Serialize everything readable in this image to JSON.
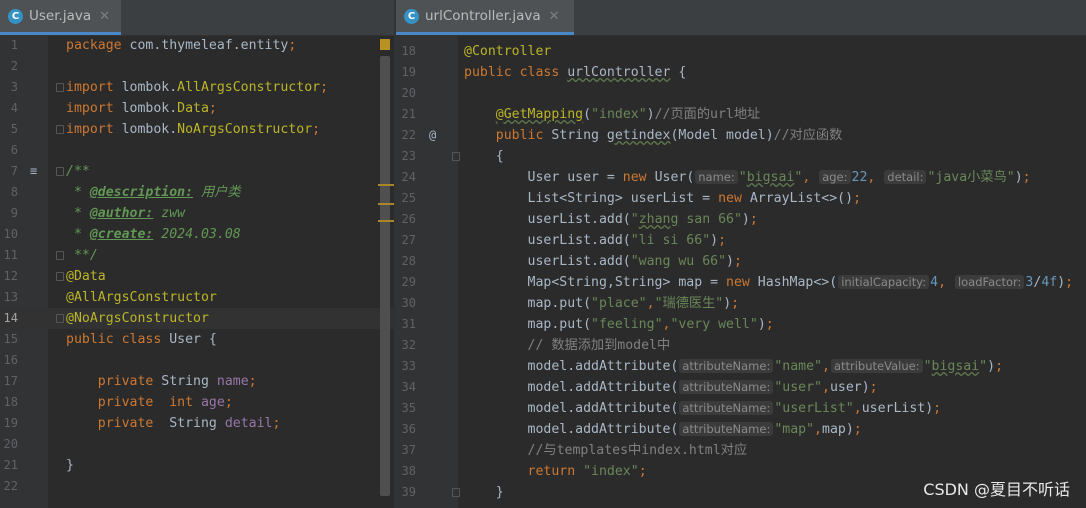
{
  "left": {
    "tab": {
      "label": "User.java",
      "icon": "C"
    },
    "lines": [
      {
        "n": "1",
        "html": "<span class=\"kw\">package </span>com.thymeleaf.entity<span class=\"kw\">;</span>"
      },
      {
        "n": "2",
        "html": ""
      },
      {
        "n": "3",
        "html": "<span class=\"kw\">import </span>lombok.<span class=\"an\">AllArgsConstructor</span><span class=\"kw\">;</span>"
      },
      {
        "n": "4",
        "html": "<span class=\"kw\">import </span>lombok.<span class=\"an\">Data</span><span class=\"kw\">;</span>"
      },
      {
        "n": "5",
        "html": "<span class=\"kw\">import </span>lombok.<span class=\"an\">NoArgsConstructor</span><span class=\"kw\">;</span>"
      },
      {
        "n": "6",
        "html": ""
      },
      {
        "n": "7",
        "html": "<span class=\"dc\">/**</span>"
      },
      {
        "n": "8",
        "html": "<span class=\"dc\"> * </span><span class=\"dt\">@description:</span><span class=\"dc\"> 用户类</span>"
      },
      {
        "n": "9",
        "html": "<span class=\"dc\"> * </span><span class=\"dt\">@author:</span><span class=\"dc\"> zww</span>"
      },
      {
        "n": "10",
        "html": "<span class=\"dc\"> * </span><span class=\"dt\">@create:</span><span class=\"dc\"> 2024.03.08</span>"
      },
      {
        "n": "11",
        "html": "<span class=\"dc\"> **/</span>"
      },
      {
        "n": "12",
        "html": "<span class=\"an\">@Data</span>"
      },
      {
        "n": "13",
        "html": "<span class=\"an\">@AllArgsConstructor</span>"
      },
      {
        "n": "14",
        "html": "<span class=\"an\">@NoArgsConstructor</span>"
      },
      {
        "n": "15",
        "html": "<span class=\"kw\">public class </span>User {"
      },
      {
        "n": "16",
        "html": ""
      },
      {
        "n": "17",
        "html": "    <span class=\"kw\">private </span>String <span class=\"fd\">name</span><span class=\"kw\">;</span>"
      },
      {
        "n": "18",
        "html": "    <span class=\"kw\">private  int </span><span class=\"fd\">age</span><span class=\"kw\">;</span>"
      },
      {
        "n": "19",
        "html": "    <span class=\"kw\">private  </span>String <span class=\"fd\">detail</span><span class=\"kw\">;</span>"
      },
      {
        "n": "20",
        "html": ""
      },
      {
        "n": "21",
        "html": "}"
      },
      {
        "n": "22",
        "html": ""
      }
    ]
  },
  "right": {
    "tab": {
      "label": "urlController.java",
      "icon": "C"
    },
    "lines": [
      {
        "n": "18",
        "html": "<span class=\"an\">@Controller</span>"
      },
      {
        "n": "19",
        "html": "<span class=\"kw\">public class </span><span class=\"wavy\">urlController</span> {"
      },
      {
        "n": "20",
        "html": ""
      },
      {
        "n": "21",
        "html": "    <span class=\"an wavy\">@GetMapping</span>(<span class=\"st\">\"index\"</span>)<span class=\"cm\">//页面的url地址</span>"
      },
      {
        "n": "22",
        "html": "    <span class=\"kw\">public </span>String <span class=\"wavy\">getindex</span>(Model model)<span class=\"cm\">//对应函数</span>"
      },
      {
        "n": "23",
        "html": "    {"
      },
      {
        "n": "24",
        "html": "        User user = <span class=\"kw\">new </span>User(<span class=\"hint\">name:</span><span class=\"st\">\"<span class=\"wavy\">bigsai</span>\"</span><span class=\"kw\">, </span><span class=\"hint\">age:</span><span class=\"nm\">22</span><span class=\"kw\">, </span><span class=\"hint\">detail:</span><span class=\"st\">\"java小菜鸟\"</span>)<span class=\"kw\">;</span>"
      },
      {
        "n": "25",
        "html": "        List&lt;String&gt; userList = <span class=\"kw\">new </span>ArrayList&lt;&gt;()<span class=\"kw\">;</span>"
      },
      {
        "n": "26",
        "html": "        userList.add(<span class=\"st\">\"<span class=\"wavy\">zhang</span> san 66\"</span>)<span class=\"kw\">;</span>"
      },
      {
        "n": "27",
        "html": "        userList.add(<span class=\"st\">\"li si 66\"</span>)<span class=\"kw\">;</span>"
      },
      {
        "n": "28",
        "html": "        userList.add(<span class=\"st\">\"wang wu 66\"</span>)<span class=\"kw\">;</span>"
      },
      {
        "n": "29",
        "html": "        Map&lt;String,String&gt; map = <span class=\"kw\">new </span>HashMap&lt;&gt;(<span class=\"hint\">initialCapacity:</span><span class=\"nm\">4</span><span class=\"kw\">, </span><span class=\"hint\">loadFactor:</span><span class=\"nm\">3</span>/<span class=\"nm\">4f</span>)<span class=\"kw\">;</span>"
      },
      {
        "n": "30",
        "html": "        map.put(<span class=\"st\">\"place\"</span><span class=\"kw\">,</span><span class=\"st\">\"瑞德医生\"</span>)<span class=\"kw\">;</span>"
      },
      {
        "n": "31",
        "html": "        map.put(<span class=\"st\">\"feeling\"</span><span class=\"kw\">,</span><span class=\"st\">\"very well\"</span>)<span class=\"kw\">;</span>"
      },
      {
        "n": "32",
        "html": "        <span class=\"cm\">// 数据添加到model中</span>"
      },
      {
        "n": "33",
        "html": "        model.addAttribute(<span class=\"hint\">attributeName:</span><span class=\"st\">\"name\"</span><span class=\"kw\">,</span><span class=\"hint\">attributeValue:</span><span class=\"st\">\"<span class=\"wavy\">bigsai</span>\"</span>)<span class=\"kw\">;</span>"
      },
      {
        "n": "34",
        "html": "        model.addAttribute(<span class=\"hint\">attributeName:</span><span class=\"st\">\"user\"</span><span class=\"kw\">,</span>user)<span class=\"kw\">;</span>"
      },
      {
        "n": "35",
        "html": "        model.addAttribute(<span class=\"hint\">attributeName:</span><span class=\"st\">\"userList\"</span><span class=\"kw\">,</span>userList)<span class=\"kw\">;</span>"
      },
      {
        "n": "36",
        "html": "        model.addAttribute(<span class=\"hint\">attributeName:</span><span class=\"st\">\"map\"</span><span class=\"kw\">,</span>map)<span class=\"kw\">;</span>"
      },
      {
        "n": "37",
        "html": "        <span class=\"cm\">//与templates中index.html对应</span>"
      },
      {
        "n": "38",
        "html": "        <span class=\"kw\">return </span><span class=\"st\">\"index\"</span><span class=\"kw\">;</span>"
      },
      {
        "n": "39",
        "html": "    }"
      }
    ]
  },
  "watermark": "CSDN @夏目不听话",
  "colors": {
    "keyword": "#cc7832",
    "annotation": "#bbb529",
    "string": "#6a8759",
    "comment": "#808080",
    "number": "#6897bb",
    "field": "#9876aa",
    "background": "#2b2b2b",
    "accent": "#4a88c7"
  }
}
